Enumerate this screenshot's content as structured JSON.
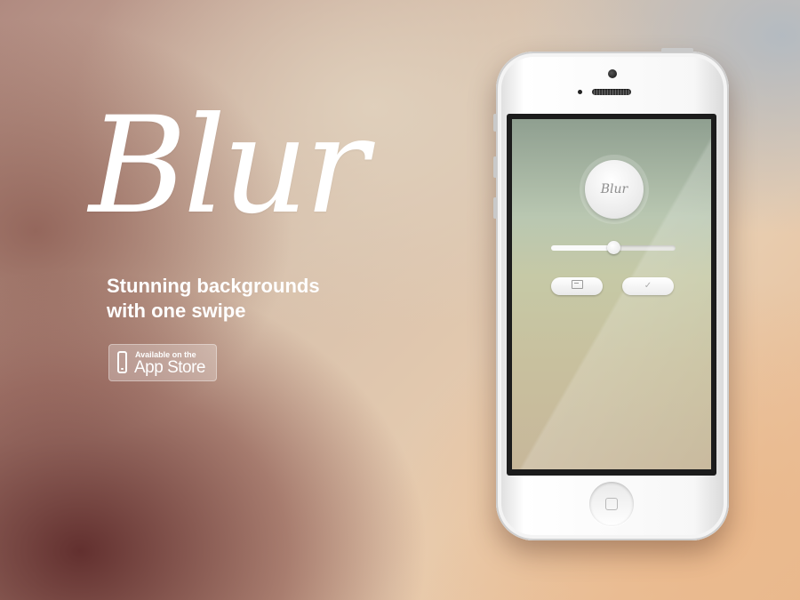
{
  "brand": {
    "logo_text": "Blur",
    "tagline_line1": "Stunning backgrounds",
    "tagline_line2": "with one swipe"
  },
  "app_store_badge": {
    "small_text": "Available on the",
    "big_text": "App Store"
  },
  "app_screen": {
    "blur_button_label": "Blur",
    "slider_value_percent": 50,
    "left_button_icon": "image-icon",
    "right_button_label": "✓"
  },
  "colors": {
    "text_primary": "#ffffff",
    "phone_body": "#f7f7f7"
  }
}
